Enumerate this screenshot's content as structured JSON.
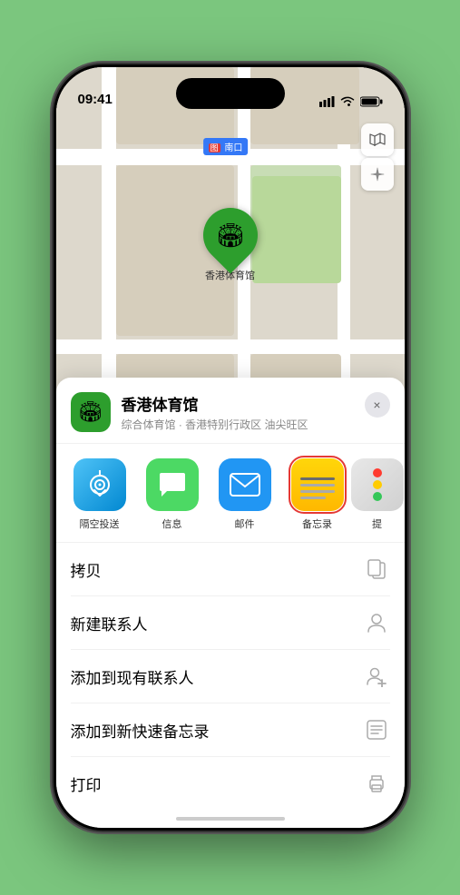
{
  "status_bar": {
    "time": "09:41",
    "location_arrow": true
  },
  "map": {
    "label": "南口",
    "label_prefix": "图"
  },
  "venue": {
    "name": "香港体育馆",
    "description": "综合体育馆 · 香港特别行政区 油尖旺区"
  },
  "share_items": [
    {
      "id": "airdrop",
      "label": "隔空投送",
      "type": "airdrop"
    },
    {
      "id": "message",
      "label": "信息",
      "type": "message"
    },
    {
      "id": "mail",
      "label": "邮件",
      "type": "mail"
    },
    {
      "id": "notes",
      "label": "备忘录",
      "type": "notes"
    },
    {
      "id": "more",
      "label": "提",
      "type": "more"
    }
  ],
  "actions": [
    {
      "id": "copy",
      "label": "拷贝",
      "icon": "copy"
    },
    {
      "id": "new-contact",
      "label": "新建联系人",
      "icon": "person"
    },
    {
      "id": "add-to-contact",
      "label": "添加到现有联系人",
      "icon": "person-add"
    },
    {
      "id": "add-to-notes",
      "label": "添加到新快速备忘录",
      "icon": "quick-note"
    },
    {
      "id": "print",
      "label": "打印",
      "icon": "print"
    }
  ],
  "close_label": "×"
}
